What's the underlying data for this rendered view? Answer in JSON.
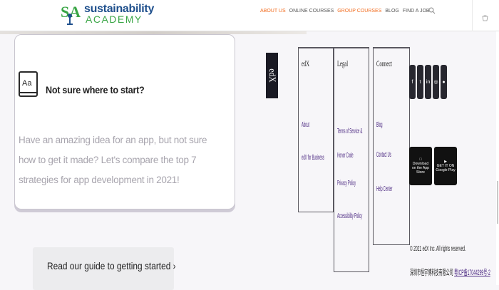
{
  "header": {
    "logo_mark": "SA",
    "logo_top": "sustainability",
    "logo_bottom": "ACADEMY",
    "nav": [
      "ABOUT US",
      "ONLINE COURSES",
      "GROUP COURSES",
      "BLOG",
      "FIND A JOB"
    ],
    "accent_color": "#f26b1d"
  },
  "card": {
    "icon_text": "Aa",
    "title": "Not sure where to start?",
    "body": "Have an amazing idea for an app, but not sure how to get it made? Let's compare the top 7 strategies for app development in 2021!",
    "cta": "Read our guide to getting started ›"
  },
  "footer": {
    "logo": "edX",
    "columns": [
      {
        "title": "edX",
        "links": [
          "About",
          "edX for Business"
        ]
      },
      {
        "title": "Legal",
        "links": [
          "Terms of Service & Honor Code",
          "Privacy Policy",
          "Accessibility Policy"
        ]
      },
      {
        "title": "Connect",
        "links": [
          "Blog",
          "Contact Us",
          "Help Center"
        ]
      }
    ],
    "social_icons": [
      "facebook-icon",
      "twitter-icon",
      "linkedin-icon",
      "instagram-icon",
      "reddit-icon"
    ],
    "app_store": "Download on the App Store",
    "google_play": "GET IT ON Google Play",
    "copyright": "© 2021 edX Inc. All rights reserved.",
    "icp_text": "深圳市恒宇博科技有限公司",
    "icp_link": "粤ICP备17044299号-2"
  }
}
